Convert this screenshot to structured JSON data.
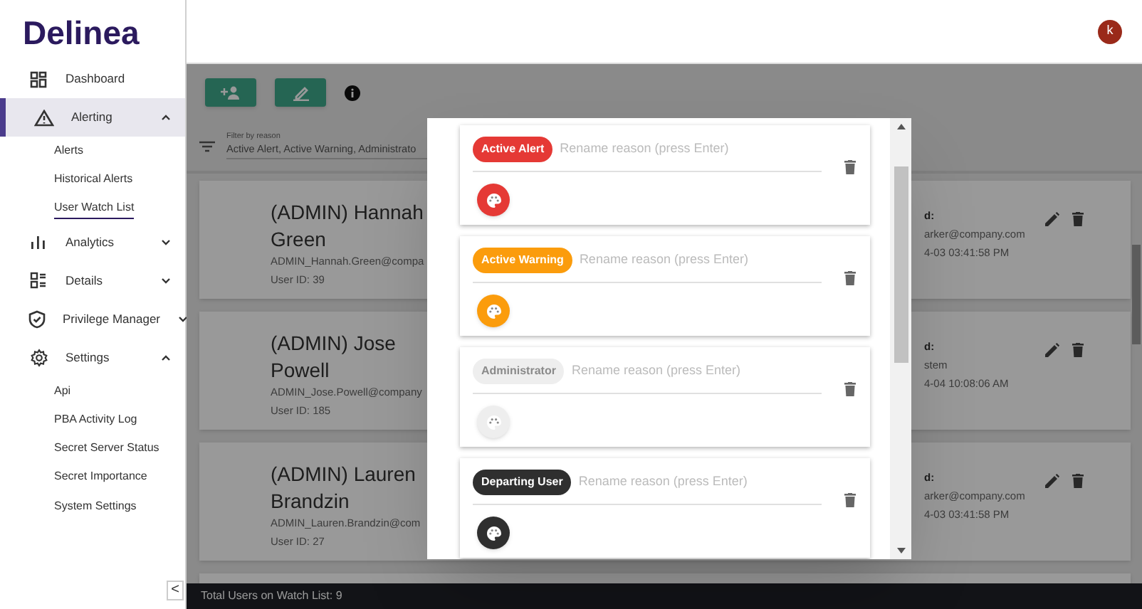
{
  "sidebar": {
    "logo": "Delinea",
    "items": [
      {
        "label": "Dashboard",
        "selected": false
      },
      {
        "label": "Alerting",
        "expanded": true,
        "selected": true,
        "children": [
          {
            "label": "Alerts",
            "selected": false
          },
          {
            "label": "Historical Alerts",
            "selected": false
          },
          {
            "label": "User Watch List",
            "selected": true
          }
        ]
      },
      {
        "label": "Analytics",
        "expanded": false,
        "selected": false
      },
      {
        "label": "Details",
        "expanded": false,
        "selected": false
      },
      {
        "label": "Privilege Manager",
        "expanded": false,
        "selected": false
      },
      {
        "label": "Settings",
        "expanded": true,
        "selected": false,
        "children": [
          {
            "label": "Api",
            "selected": false
          },
          {
            "label": "PBA Activity Log",
            "selected": false
          },
          {
            "label": "Secret Server Status",
            "selected": false
          },
          {
            "label": "Secret Importance",
            "selected": false
          },
          {
            "label": "System Settings",
            "selected": false
          }
        ]
      }
    ],
    "collapse": "<"
  },
  "header": {
    "avatar": "k"
  },
  "filter": {
    "label": "Filter by reason",
    "value": "Active Alert, Active Warning, Administrato"
  },
  "users": [
    {
      "name": "(ADMIN) Hannah Green",
      "email": "ADMIN_Hannah.Green@compa",
      "user_id": "User ID: 39",
      "right": [
        "d:",
        "arker@company.com",
        "4-03 03:41:58 PM"
      ]
    },
    {
      "name": "(ADMIN) Jose Powell",
      "email": "ADMIN_Jose.Powell@company",
      "user_id": "User ID: 185",
      "right": [
        "d:",
        "stem",
        "4-04 10:08:06 AM"
      ]
    },
    {
      "name": "(ADMIN) Lauren Brandzin",
      "email": "ADMIN_Lauren.Brandzin@com",
      "user_id": "User ID: 27",
      "right": [
        "d:",
        "arker@company.com",
        "4-03 03:41:58 PM"
      ]
    }
  ],
  "footer": "Total Users on Watch List: 9",
  "reasons": [
    {
      "name": "Active Alert",
      "color": "#e53935",
      "placeholder": "Rename reason (press Enter)"
    },
    {
      "name": "Active Warning",
      "color": "#fb9c0c",
      "placeholder": "Rename reason (press Enter)"
    },
    {
      "name": "Administrator",
      "color": "#eeeeee",
      "placeholder": "Rename reason (press Enter)"
    },
    {
      "name": "Departing User",
      "color": "#2f2f2f",
      "placeholder": "Rename reason (press Enter)"
    }
  ]
}
